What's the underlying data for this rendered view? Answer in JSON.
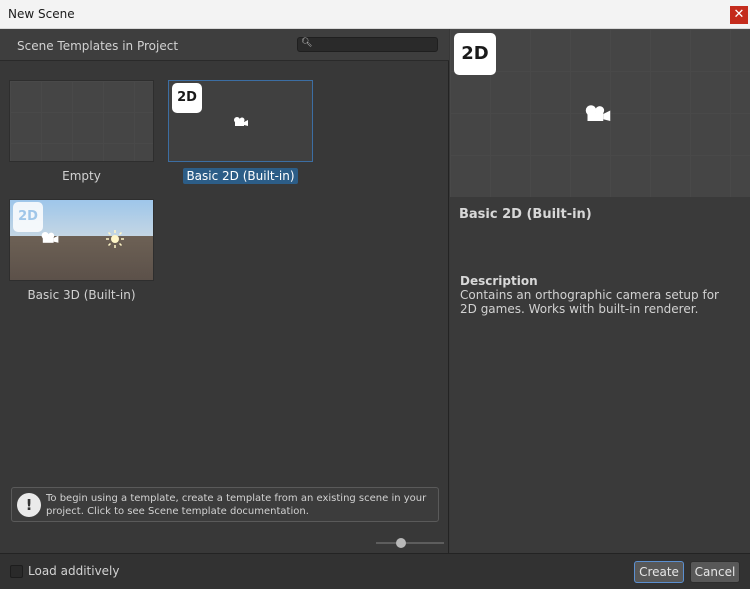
{
  "window": {
    "title": "New Scene",
    "close_glyph": "✕"
  },
  "left": {
    "heading": "Scene Templates in Project",
    "search": {
      "placeholder": "",
      "value": ""
    },
    "templates": [
      {
        "label": "Empty"
      },
      {
        "label": "Basic 2D (Built-in)",
        "badge": "2D",
        "selected": true
      },
      {
        "label": "Basic 3D (Built-in)",
        "badge": "2D"
      }
    ],
    "info_badge": "!",
    "info_text": "To begin using a template, create a template from an existing scene in your project. Click to see Scene template documentation."
  },
  "right": {
    "badge": "2D",
    "title": "Basic 2D (Built-in)",
    "description_label": "Description",
    "description": "Contains an orthographic camera setup for 2D games. Works with built-in renderer."
  },
  "footer": {
    "load_additively_label": "Load additively",
    "create_label": "Create",
    "cancel_label": "Cancel"
  },
  "colors": {
    "accent": "#2c5d87",
    "close": "#c42b1c",
    "create_border": "#5b8fd0"
  },
  "icons": [
    "search-icon",
    "camera-icon",
    "sun-icon",
    "info-icon",
    "close-icon"
  ]
}
